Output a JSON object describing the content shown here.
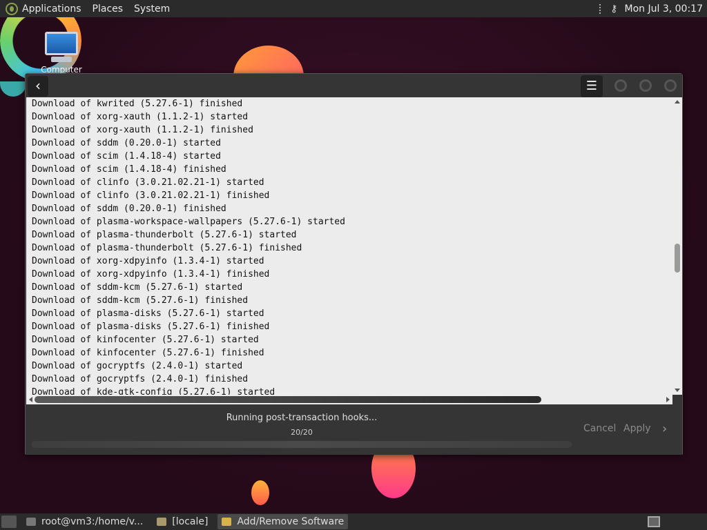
{
  "top_panel": {
    "menus": [
      "Applications",
      "Places",
      "System"
    ],
    "clock": "Mon Jul 3, 00:17"
  },
  "desktop": {
    "icons": [
      {
        "label": "Computer"
      }
    ]
  },
  "window": {
    "log_lines": [
      "Download of kwrited (5.27.6-1) finished",
      "Download of xorg-xauth (1.1.2-1) started",
      "Download of xorg-xauth (1.1.2-1) finished",
      "Download of sddm (0.20.0-1) started",
      "Download of scim (1.4.18-4) started",
      "Download of scim (1.4.18-4) finished",
      "Download of clinfo (3.0.21.02.21-1) started",
      "Download of clinfo (3.0.21.02.21-1) finished",
      "Download of sddm (0.20.0-1) finished",
      "Download of plasma-workspace-wallpapers (5.27.6-1) started",
      "Download of plasma-thunderbolt (5.27.6-1) started",
      "Download of plasma-thunderbolt (5.27.6-1) finished",
      "Download of xorg-xdpyinfo (1.3.4-1) started",
      "Download of xorg-xdpyinfo (1.3.4-1) finished",
      "Download of sddm-kcm (5.27.6-1) started",
      "Download of sddm-kcm (5.27.6-1) finished",
      "Download of plasma-disks (5.27.6-1) started",
      "Download of plasma-disks (5.27.6-1) finished",
      "Download of kinfocenter (5.27.6-1) started",
      "Download of kinfocenter (5.27.6-1) finished",
      "Download of gocryptfs (2.4.0-1) started",
      "Download of gocryptfs (2.4.0-1) finished",
      "Download of kde-gtk-config (5.27.6-1) started"
    ],
    "status_text": "Running post-transaction hooks...",
    "status_count": "20/20",
    "progress": 1.0,
    "cancel_label": "Cancel",
    "apply_label": "Apply"
  },
  "taskbar": {
    "items": [
      {
        "label": "root@vm3:/home/v...",
        "active": false
      },
      {
        "label": "[locale]",
        "active": false
      },
      {
        "label": "Add/Remove Software",
        "active": true
      }
    ]
  },
  "colors": {
    "panel_bg": "#2b2b2b",
    "window_bg": "#353535",
    "log_bg": "#ececec"
  }
}
